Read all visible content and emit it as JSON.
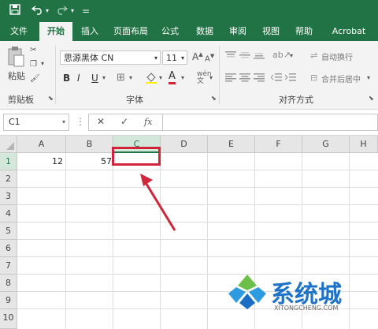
{
  "ribbon_tabs": [
    "文件",
    "开始",
    "插入",
    "页面布局",
    "公式",
    "数据",
    "审阅",
    "视图",
    "帮助",
    "Acrobat"
  ],
  "active_tab": "开始",
  "clipboard": {
    "paste_label": "粘贴",
    "group_label": "剪贴板"
  },
  "font": {
    "name": "思源黑体 CN",
    "size": "11",
    "group_label": "字体",
    "bold": "B",
    "italic": "I",
    "underline": "U"
  },
  "alignment": {
    "wrap_label": "自动换行",
    "merge_label": "合并后居中",
    "group_label": "对齐方式"
  },
  "name_box": "C1",
  "formula_icons": {
    "cancel": "✕",
    "enter": "✓",
    "fx": "fx"
  },
  "columns": [
    "A",
    "B",
    "C",
    "D",
    "E",
    "F",
    "G",
    "H"
  ],
  "rows": [
    "1",
    "2",
    "3",
    "4",
    "5",
    "6",
    "7",
    "8",
    "9",
    "10"
  ],
  "cells": {
    "A1": "12",
    "B1": "57"
  },
  "selected_cell": "C1",
  "watermark": {
    "brand": "系统城",
    "url": "XITONGCHENG.COM"
  },
  "colors": {
    "accent": "#217346",
    "highlight": "#d0253a"
  }
}
